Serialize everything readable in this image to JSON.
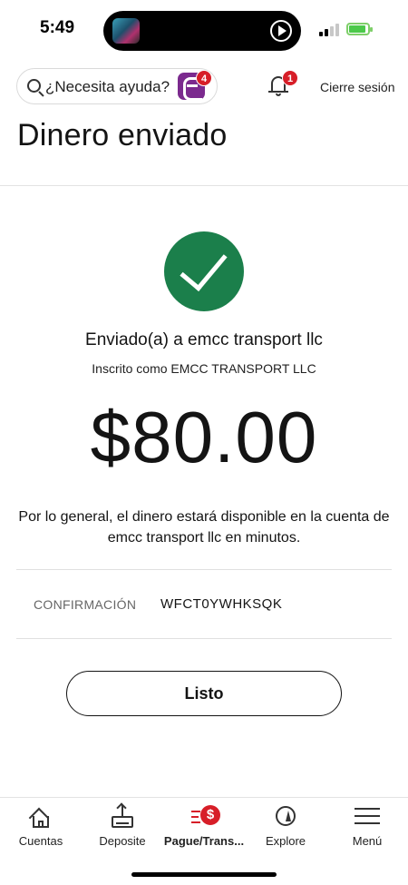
{
  "status_bar": {
    "time": "5:49"
  },
  "header": {
    "search_label": "¿Necesita ayuda?",
    "chat_badge_count": "4",
    "notifications_badge_count": "1",
    "signout_label": "Cierre sesión"
  },
  "page": {
    "title": "Dinero enviado"
  },
  "confirmation": {
    "status_icon": "checkmark-circle",
    "sent_to": "Enviado(a) a emcc transport llc",
    "enrolled_as": "Inscrito como EMCC TRANSPORT LLC",
    "amount": "$80.00",
    "notice": "Por lo general, el dinero estará disponible en la cuenta de emcc transport llc en minutos.",
    "confirmation_label": "CONFIRMACIÓN",
    "confirmation_number": "WFCT0YWHKSQK",
    "done_label": "Listo"
  },
  "bottom_nav": {
    "items": [
      {
        "label": "Cuentas",
        "icon": "house-icon"
      },
      {
        "label": "Deposite",
        "icon": "deposit-icon"
      },
      {
        "label": "Pague/Trans...",
        "icon": "pay-transfer-icon",
        "active": true
      },
      {
        "label": "Explore",
        "icon": "compass-icon"
      },
      {
        "label": "Menú",
        "icon": "menu-icon"
      }
    ]
  },
  "colors": {
    "success_green": "#1b7f4b",
    "brand_red": "#d71e28",
    "chat_purple": "#7b2a8e"
  }
}
